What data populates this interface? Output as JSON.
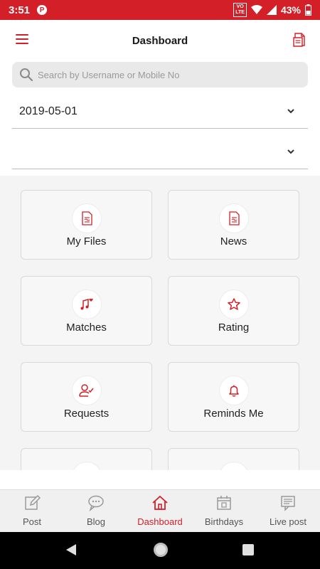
{
  "status_bar": {
    "time": "3:51",
    "app_icon": "P",
    "volte_top": "VO",
    "volte_bottom": "LTE",
    "battery": "43%"
  },
  "header": {
    "title": "Dashboard"
  },
  "search": {
    "placeholder": "Search by Username or Mobile No"
  },
  "filters": {
    "date_value": "2019-05-01",
    "second_value": ""
  },
  "tiles": [
    {
      "label": "My Files",
      "icon": "document-icon"
    },
    {
      "label": "News",
      "icon": "news-icon"
    },
    {
      "label": "Matches",
      "icon": "music-heart-icon"
    },
    {
      "label": "Rating",
      "icon": "star-icon"
    },
    {
      "label": "Requests",
      "icon": "user-check-icon"
    },
    {
      "label": "Reminds Me",
      "icon": "bell-icon"
    },
    {
      "label": "",
      "icon": "partial-icon"
    },
    {
      "label": "",
      "icon": "partial-icon"
    }
  ],
  "bottom_nav": [
    {
      "label": "Post",
      "icon": "edit-icon",
      "active": false
    },
    {
      "label": "Blog",
      "icon": "chat-icon",
      "active": false
    },
    {
      "label": "Dashboard",
      "icon": "home-icon",
      "active": true
    },
    {
      "label": "Birthdays",
      "icon": "calendar-icon",
      "active": false
    },
    {
      "label": "Live post",
      "icon": "live-post-icon",
      "active": false
    }
  ],
  "colors": {
    "accent": "#d32028",
    "background": "#f4f4f4"
  }
}
